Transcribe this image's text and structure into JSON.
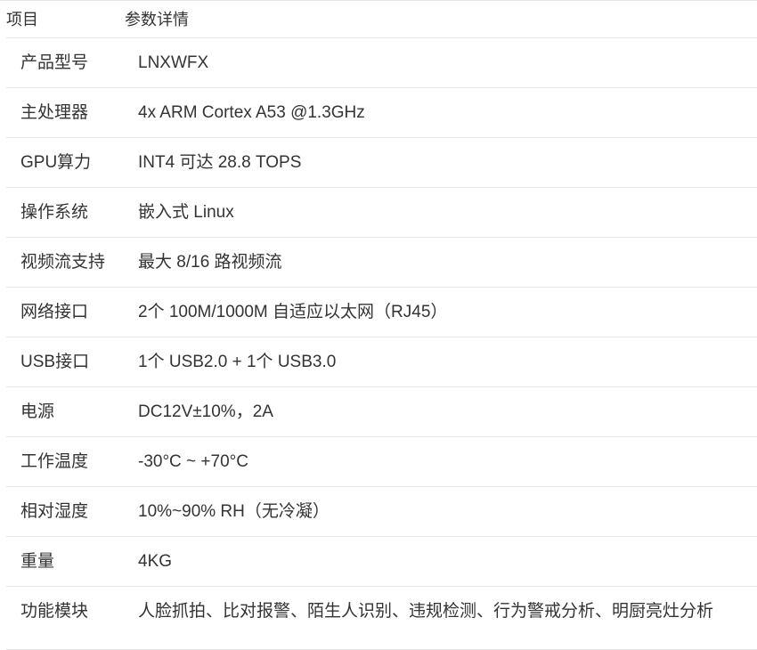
{
  "header": {
    "item": "项目",
    "detail": "参数详情"
  },
  "rows": [
    {
      "label": "产品型号",
      "value": "LNXWFX"
    },
    {
      "label": "主处理器",
      "value": "4x ARM Cortex A53 @1.3GHz"
    },
    {
      "label": "GPU算力",
      "value": "INT4 可达 28.8 TOPS"
    },
    {
      "label": "操作系统",
      "value": "嵌入式 Linux"
    },
    {
      "label": "视频流支持",
      "value": "最大 8/16 路视频流"
    },
    {
      "label": "网络接口",
      "value": "2个 100M/1000M 自适应以太网（RJ45）"
    },
    {
      "label": "USB接口",
      "value": "1个 USB2.0 + 1个 USB3.0"
    },
    {
      "label": "电源",
      "value": "DC12V±10%，2A"
    },
    {
      "label": "工作温度",
      "value": "-30°C ~ +70°C"
    },
    {
      "label": "相对湿度",
      "value": "10%~90% RH（无冷凝）"
    },
    {
      "label": "重量",
      "value": "4KG"
    },
    {
      "label": "功能模块",
      "value": "人脸抓拍、比对报警、陌生人识别、违规检测、行为警戒分析、明厨亮灶分析"
    }
  ]
}
